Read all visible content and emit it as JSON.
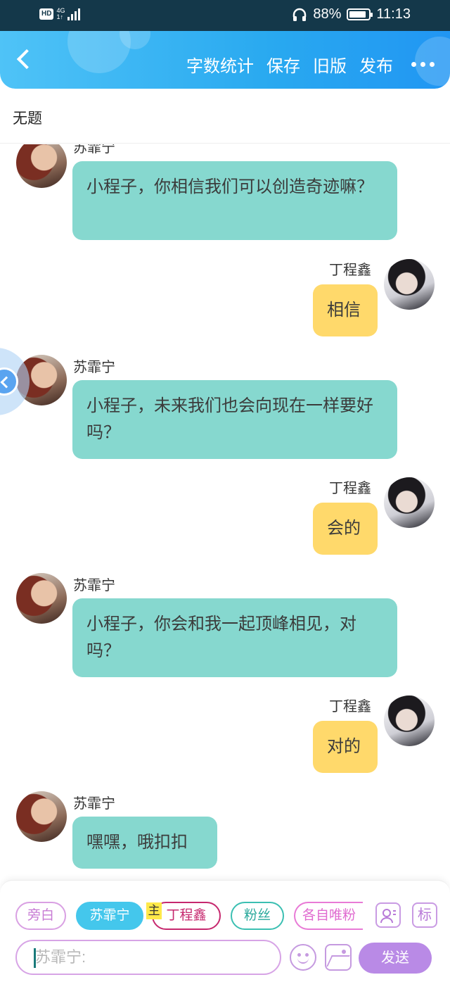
{
  "status_bar": {
    "hd": "HD",
    "network_top": "4G",
    "network_bottom": "1↑",
    "battery_percent": "88%",
    "battery_level": 0.88,
    "time": "11:13"
  },
  "header": {
    "actions": [
      "字数统计",
      "保存",
      "旧版",
      "发布"
    ]
  },
  "title": "无题",
  "messages": [
    {
      "side": "left",
      "sender": "苏霏宁",
      "text": "小程子，你相信我们可以创造奇迹嘛？"
    },
    {
      "side": "right",
      "sender": "丁程鑫",
      "text": "相信"
    },
    {
      "side": "left",
      "sender": "苏霏宁",
      "text": "小程子，未来我们也会向现在一样要好吗？"
    },
    {
      "side": "right",
      "sender": "丁程鑫",
      "text": "会的"
    },
    {
      "side": "left",
      "sender": "苏霏宁",
      "text": "小程子，你会和我一起顶峰相见，对吗？"
    },
    {
      "side": "right",
      "sender": "丁程鑫",
      "text": "对的"
    },
    {
      "side": "left",
      "sender": "苏霏宁",
      "text": "嘿嘿，哦扣扣"
    }
  ],
  "composer": {
    "chips": [
      "旁白",
      "苏霏宁",
      "丁程鑫",
      "粉丝",
      "各自唯粉"
    ],
    "zhu_badge": "主",
    "tag_icon_label": "标",
    "input_placeholder": "苏霏宁:",
    "send_label": "发送"
  },
  "colors": {
    "header_gradient_start": "#4fc3f7",
    "header_gradient_end": "#2196f3",
    "left_bubble": "#86d8cf",
    "right_bubble": "#ffd96b",
    "send_button": "#b98ae6"
  }
}
